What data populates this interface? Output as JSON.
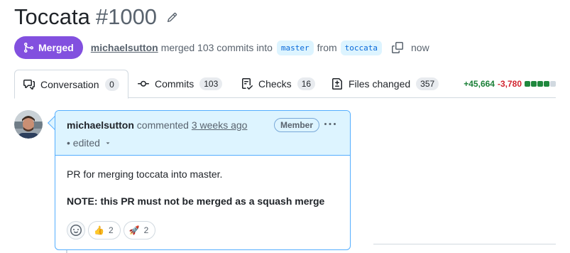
{
  "pr": {
    "title": "Toccata",
    "number": "#1000"
  },
  "status": {
    "badge": "Merged",
    "author": "michaelsutton",
    "merged_text": "merged 103 commits into",
    "base_branch": "master",
    "from_text": "from",
    "head_branch": "toccata",
    "time": "now",
    "badge_color": "#8250df"
  },
  "tabs": [
    {
      "label": "Conversation",
      "count": "0",
      "icon": "comment-discussion-icon"
    },
    {
      "label": "Commits",
      "count": "103",
      "icon": "git-commit-icon"
    },
    {
      "label": "Checks",
      "count": "16",
      "icon": "checklist-icon"
    },
    {
      "label": "Files changed",
      "count": "357",
      "icon": "file-diff-icon"
    }
  ],
  "diffstat": {
    "additions": "+45,664",
    "deletions": "-3,780",
    "blocks": [
      "green",
      "green",
      "green",
      "green",
      "gray"
    ],
    "add_color": "#1a7f37",
    "del_color": "#d1242f"
  },
  "comment": {
    "author": "michaelsutton",
    "action": "commented",
    "when": "3 weeks ago",
    "edited": "• edited",
    "role_badge": "Member",
    "body_line1": "PR for merging toccata into master.",
    "body_line2": "NOTE: this PR must not be merged as a squash merge",
    "reactions": [
      {
        "emoji": "👍",
        "icon": "thumbs-up-icon",
        "count": "2"
      },
      {
        "emoji": "🚀",
        "icon": "rocket-icon",
        "count": "2"
      }
    ]
  }
}
